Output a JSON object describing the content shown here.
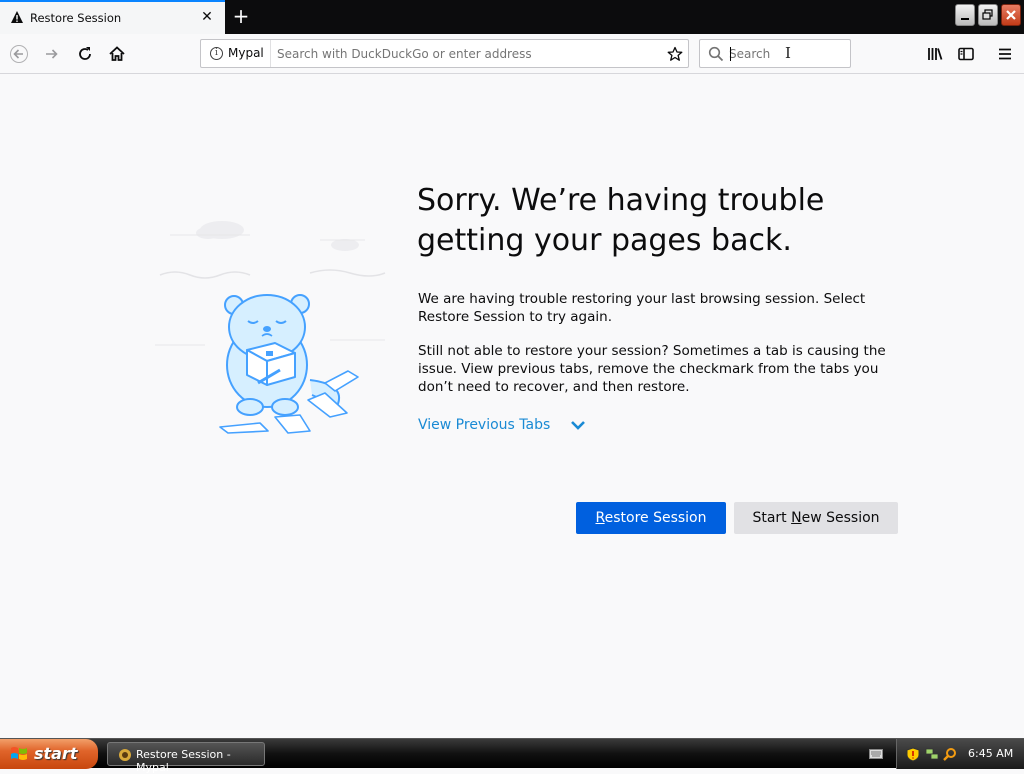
{
  "tab": {
    "title": "Restore Session",
    "close_label": "✕",
    "new_tab_label": "+"
  },
  "toolbar": {
    "identity_label": "Mypal",
    "url_placeholder": "Search with DuckDuckGo or enter address",
    "search_placeholder": "Search"
  },
  "content": {
    "heading": "Sorry. We’re having trouble getting your pages back.",
    "para1": "We are having trouble restoring your last browsing session. Select Restore Session to try again.",
    "para2": "Still not able to restore your session? Sometimes a tab is causing the issue. View previous tabs, remove the checkmark from the tabs you don’t need to recover, and then restore.",
    "view_tabs_label": "View Previous Tabs",
    "restore_button": {
      "pre": "",
      "accel": "R",
      "post": "estore Session"
    },
    "new_session_button": {
      "pre": "Start ",
      "accel": "N",
      "post": "ew Session"
    }
  },
  "taskbar": {
    "start_label": "start",
    "task_label": "Restore Session - Mypal",
    "clock": "6:45 AM"
  },
  "colors": {
    "accent_blue": "#0060df",
    "link_blue": "#1a8ad4",
    "illustration_blue": "#45a1ff"
  },
  "icons": [
    "warning-icon",
    "close-icon",
    "plus-icon",
    "back-icon",
    "forward-icon",
    "reload-icon",
    "home-icon",
    "info-icon",
    "star-icon",
    "search-icon",
    "library-icon",
    "sidebar-icon",
    "menu-icon",
    "chevron-down-icon",
    "windows-flag-icon",
    "shield-icon",
    "speaker-icon",
    "network-icon",
    "keyboard-icon"
  ]
}
